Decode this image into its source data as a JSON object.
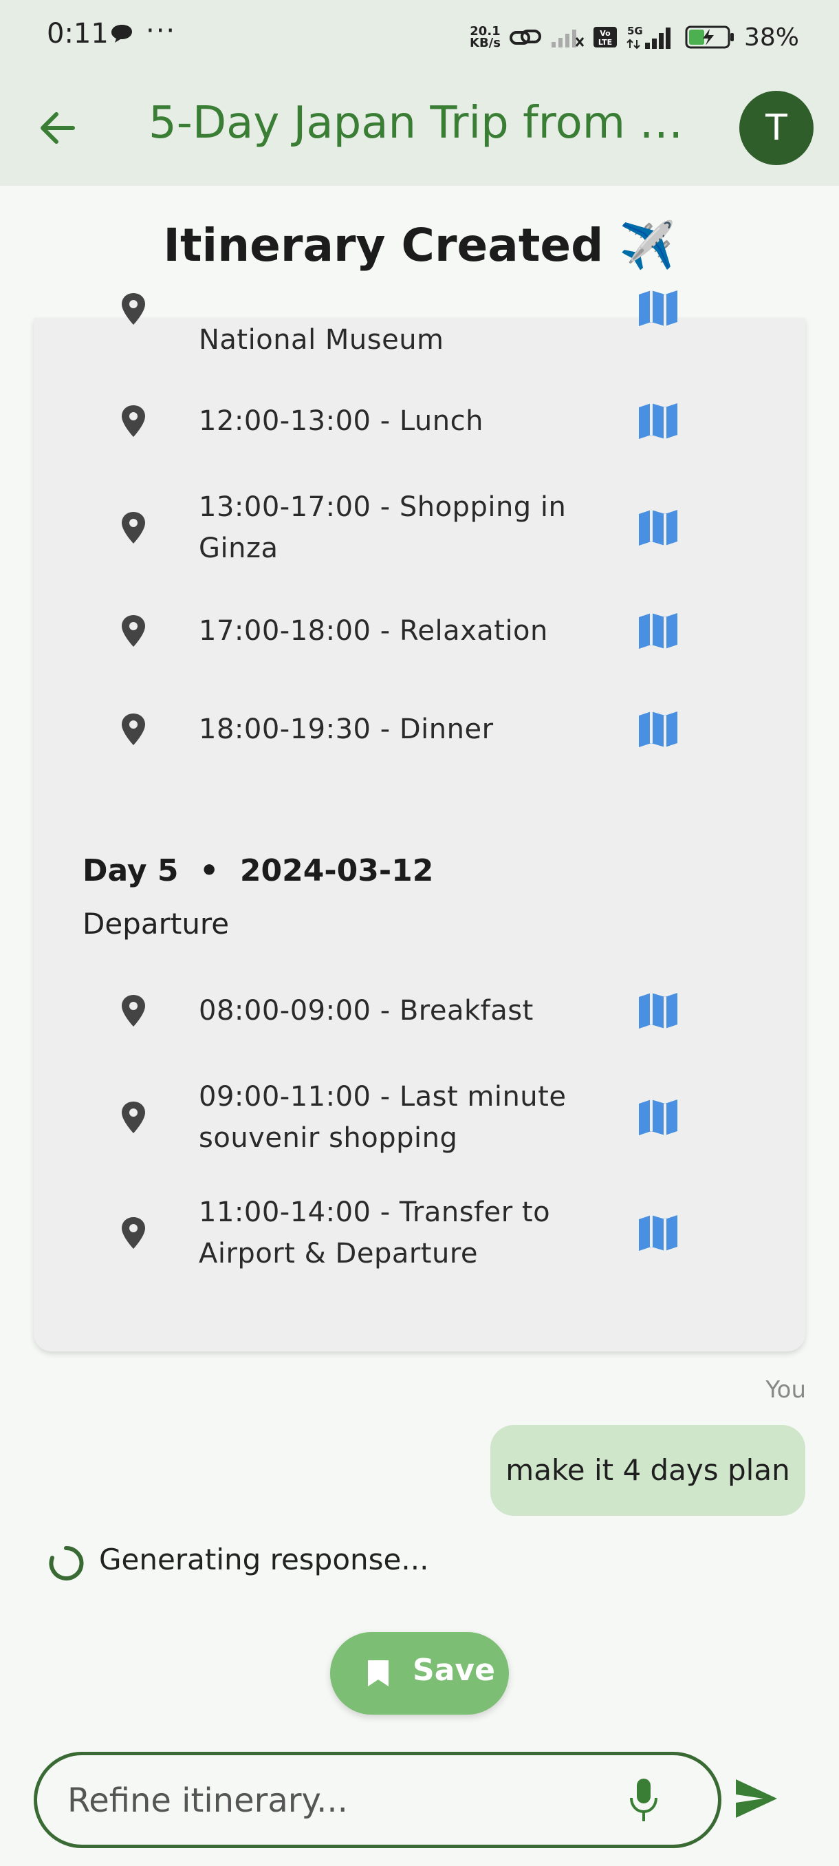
{
  "status_bar": {
    "time": "0:11",
    "dots": "···",
    "net_speed_top": "20.1",
    "net_speed_bottom": "KB/s",
    "volte": "Vo\nLTE",
    "network": "5G",
    "battery": "38%"
  },
  "app_bar": {
    "title": "5-Day Japan Trip from …",
    "avatar_initial": "T"
  },
  "header": {
    "title": "Itinerary Created",
    "emoji": "✈️"
  },
  "itinerary": {
    "day4_rows": [
      {
        "text": "National Museum"
      },
      {
        "text": "12:00-13:00 - Lunch"
      },
      {
        "text": "13:00-17:00 - Shopping in Ginza"
      },
      {
        "text": "17:00-18:00 - Relaxation"
      },
      {
        "text": "18:00-19:30 - Dinner"
      }
    ],
    "day5": {
      "heading": "Day 5  •  2024-03-12",
      "subtitle": "Departure",
      "rows": [
        {
          "text": "08:00-09:00 - Breakfast"
        },
        {
          "text": "09:00-11:00 - Last minute souvenir shopping"
        },
        {
          "text": "11:00-14:00 - Transfer to Airport & Departure"
        }
      ]
    }
  },
  "chat": {
    "sender_label": "You",
    "user_message": "make it 4 days plan",
    "status": "Generating response..."
  },
  "save_button": {
    "label": "Save"
  },
  "input": {
    "placeholder": "Refine itinerary..."
  },
  "colors": {
    "accent": "#3a7d34",
    "appbar_bg": "#e6ede5",
    "avatar_bg": "#2f5e2a",
    "map_icon": "#4a90e2",
    "save_bg": "#7cbf74",
    "bubble_bg": "#cfe6cb"
  },
  "icons": {
    "back": "arrow-left-icon",
    "pin": "location-pin-icon",
    "map": "map-icon",
    "mic": "microphone-icon",
    "send": "send-icon",
    "save": "bookmark-icon"
  }
}
